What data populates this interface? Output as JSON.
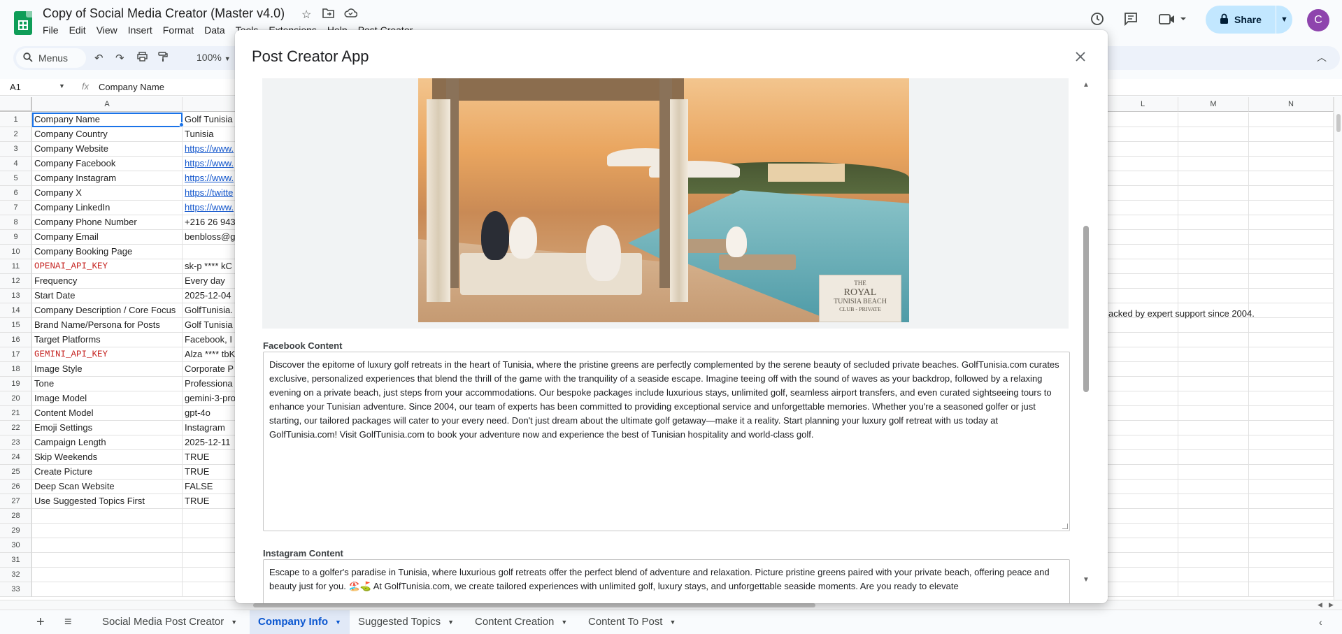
{
  "header": {
    "doc_title": "Copy of Social Media Creator (Master v4.0)",
    "menu": [
      "File",
      "Edit",
      "View",
      "Insert",
      "Format",
      "Data",
      "Tools",
      "Extensions",
      "Help",
      "Post Creator"
    ],
    "share_label": "Share",
    "avatar_letter": "C"
  },
  "toolbar": {
    "menus_label": "Menus",
    "zoom": "100%"
  },
  "formula_bar": {
    "cell_ref": "A1",
    "fx": "fx",
    "content": "Company Name"
  },
  "grid": {
    "visible_left_columns": [
      "A"
    ],
    "right_columns": [
      "L",
      "M",
      "N"
    ],
    "rows": [
      {
        "n": "1",
        "a": "Company Name",
        "b": "Golf Tunisia"
      },
      {
        "n": "2",
        "a": "Company Country",
        "b": "Tunisia"
      },
      {
        "n": "3",
        "a": "Company Website",
        "b": "https://www."
      },
      {
        "n": "4",
        "a": "Company Facebook",
        "b": "https://www."
      },
      {
        "n": "5",
        "a": "Company Instagram",
        "b": "https://www."
      },
      {
        "n": "6",
        "a": "Company X",
        "b": "https://twitte"
      },
      {
        "n": "7",
        "a": "Company LinkedIn",
        "b": "https://www."
      },
      {
        "n": "8",
        "a": "Company Phone Number",
        "b": "+216 26 943"
      },
      {
        "n": "9",
        "a": "Company Email",
        "b": "benbloss@g"
      },
      {
        "n": "10",
        "a": "Company Booking Page",
        "b": ""
      },
      {
        "n": "11",
        "a": "OPENAI_API_KEY",
        "b": "sk-p **** kC"
      },
      {
        "n": "12",
        "a": "Frequency",
        "b": "Every day"
      },
      {
        "n": "13",
        "a": "Start Date",
        "b": "2025-12-04"
      },
      {
        "n": "14",
        "a": "Company Description / Core Focus",
        "b": "GolfTunisia."
      },
      {
        "n": "15",
        "a": "Brand Name/Persona for Posts",
        "b": "Golf Tunisia"
      },
      {
        "n": "16",
        "a": "Target Platforms",
        "b": "Facebook, I"
      },
      {
        "n": "17",
        "a": "GEMINI_API_KEY",
        "b": "Alza **** tbK"
      },
      {
        "n": "18",
        "a": "Image Style",
        "b": "Corporate P"
      },
      {
        "n": "19",
        "a": "Tone",
        "b": "Professiona"
      },
      {
        "n": "20",
        "a": "Image Model",
        "b": "gemini-3-pro"
      },
      {
        "n": "21",
        "a": "Content Model",
        "b": "gpt-4o"
      },
      {
        "n": "22",
        "a": "Emoji Settings",
        "b": "Instagram"
      },
      {
        "n": "23",
        "a": "Campaign Length",
        "b": "2025-12-11"
      },
      {
        "n": "24",
        "a": "Skip Weekends",
        "b": "TRUE"
      },
      {
        "n": "25",
        "a": "Create Picture",
        "b": "TRUE"
      },
      {
        "n": "26",
        "a": "Deep Scan Website",
        "b": "FALSE"
      },
      {
        "n": "27",
        "a": "Use Suggested Topics First",
        "b": "TRUE"
      },
      {
        "n": "28",
        "a": "",
        "b": ""
      },
      {
        "n": "29",
        "a": "",
        "b": ""
      },
      {
        "n": "30",
        "a": "",
        "b": ""
      },
      {
        "n": "31",
        "a": "",
        "b": ""
      },
      {
        "n": "32",
        "a": "",
        "b": ""
      },
      {
        "n": "33",
        "a": "",
        "b": ""
      }
    ],
    "row14_overflow": "acked by expert support since 2004."
  },
  "sheet_tabs": [
    {
      "label": "Social Media Post Creator",
      "active": false
    },
    {
      "label": "Company Info",
      "active": true
    },
    {
      "label": "Suggested Topics",
      "active": false
    },
    {
      "label": "Content Creation",
      "active": false
    },
    {
      "label": "Content To Post",
      "active": false
    }
  ],
  "modal": {
    "title": "Post Creator App",
    "image_sign": [
      "THE",
      "ROYAL",
      "TUNISIA BEACH",
      "CLUB - PRIVATE"
    ],
    "facebook_label": "Facebook Content",
    "facebook_text": "Discover the epitome of luxury golf retreats in the heart of Tunisia, where the pristine greens are perfectly complemented by the serene beauty of secluded private beaches. GolfTunisia.com curates exclusive, personalized experiences that blend the thrill of the game with the tranquility of a seaside escape. Imagine teeing off with the sound of waves as your backdrop, followed by a relaxing evening on a private beach, just steps from your accommodations. Our bespoke packages include luxurious stays, unlimited golf, seamless airport transfers, and even curated sightseeing tours to enhance your Tunisian adventure. Since 2004, our team of experts has been committed to providing exceptional service and unforgettable memories. Whether you're a seasoned golfer or just starting, our tailored packages will cater to your every need. Don't just dream about the ultimate golf getaway—make it a reality. Start planning your luxury golf retreat with us today at GolfTunisia.com!   Visit GolfTunisia.com to book your adventure now and experience the best of Tunisian hospitality and world-class golf.",
    "instagram_label": "Instagram Content",
    "instagram_text": "Escape to a golfer's paradise in Tunisia, where luxurious golf retreats offer the perfect blend of adventure and relaxation. Picture pristine greens paired with your private beach, offering peace and beauty just for you. 🏖️⛳ At GolfTunisia.com, we create tailored experiences with unlimited golf, luxury stays, and unforgettable seaside moments. Are you ready to elevate"
  },
  "colors": {
    "accent": "#1a73e8",
    "share_bg": "#c2e7ff",
    "active_tab_bg": "#e1e9f7",
    "sheets_green": "#0f9d58"
  }
}
